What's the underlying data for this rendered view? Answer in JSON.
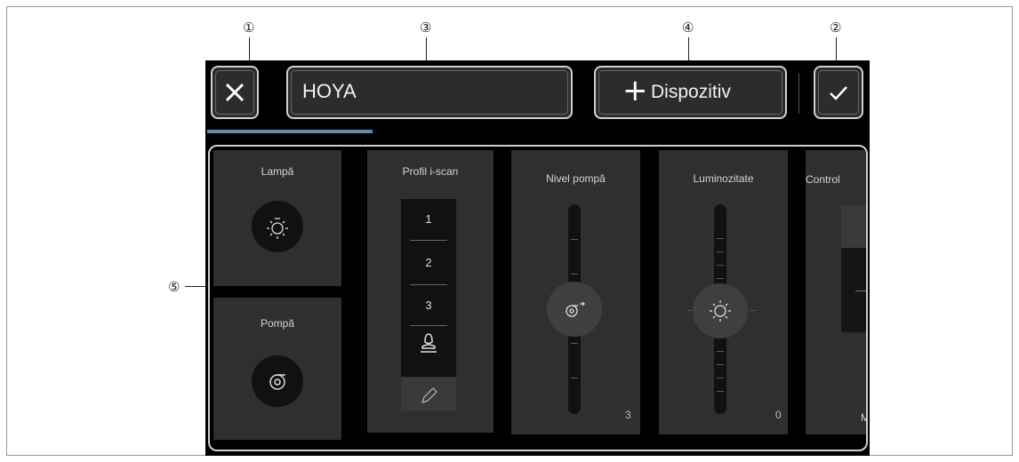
{
  "callouts": {
    "c1": "①",
    "c2": "②",
    "c3": "③",
    "c4": "④",
    "c5": "⑤"
  },
  "header": {
    "patient_name": "HOYA",
    "add_device_label": "Dispozitiv"
  },
  "tiles": {
    "lamp": {
      "title": "Lampă"
    },
    "pump": {
      "title": "Pompă"
    },
    "iscan": {
      "title": "Profil i-scan",
      "options": [
        "1",
        "2",
        "3"
      ]
    },
    "pump_level": {
      "title": "Nivel pompă",
      "value": "3"
    },
    "brightness": {
      "title": "Luminozitate",
      "value": "0"
    },
    "control": {
      "title": "Control",
      "value": "Ma"
    }
  },
  "colors": {
    "accent": "#5b8fb5",
    "background": "#000000",
    "tile": "#2f2f2f"
  }
}
